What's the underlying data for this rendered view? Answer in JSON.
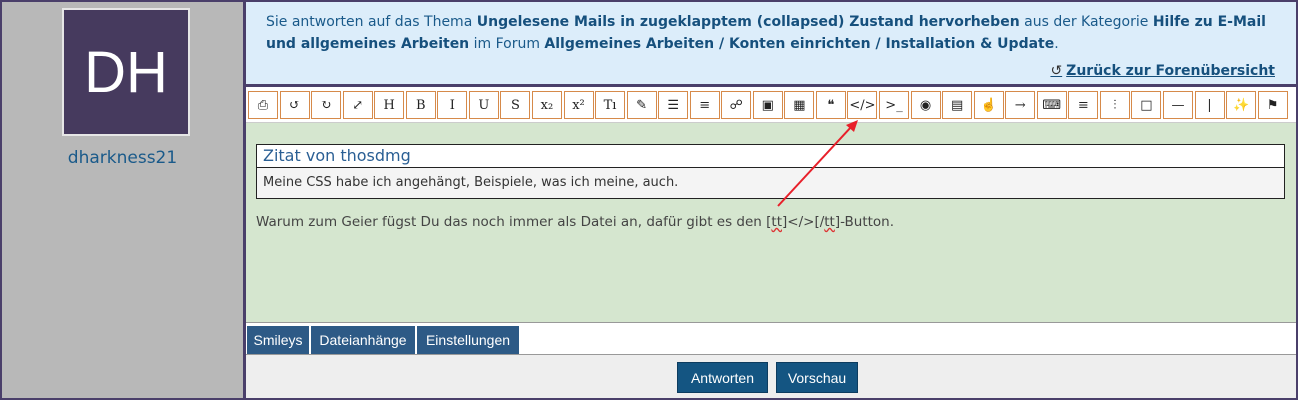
{
  "sidebar": {
    "avatar_initials": "DH",
    "username": "dharkness21"
  },
  "info": {
    "t1": "Sie antworten auf das Thema ",
    "topic": "Ungelesene Mails in zugeklapptem (collapsed) Zustand hervorheben",
    "t2": " aus der Kategorie ",
    "category": "Hilfe zu E-Mail und allgemeines Arbeiten",
    "t3": " im Forum ",
    "forum": "Allgemeines Arbeiten / Konten einrichten / Installation & Update",
    "t4": ".",
    "back_label": "Zurück zur Forenübersicht"
  },
  "toolbar": {
    "buttons": [
      "⎙",
      "↺",
      "↻",
      "⤢",
      "H",
      "B",
      "I",
      "U",
      "S",
      "x₂",
      "x²",
      "Tı",
      "✎",
      "☰",
      "≡",
      "☍",
      "▣",
      "▦",
      "❝",
      "</>",
      ">_",
      "◉",
      "▤",
      "☝",
      "→",
      "⌨",
      "≡",
      "⫶",
      "□",
      "—",
      "|",
      "✨",
      "⚑"
    ]
  },
  "editor": {
    "quote_author": "Zitat von thosdmg",
    "quote_text": "Meine CSS habe ich angehängt, Beispiele, was ich meine, auch.",
    "text_a": "Warum zum Geier fügst Du das noch immer als Datei an, dafür gibt es den [",
    "text_b": "tt",
    "text_c": "]</>[/",
    "text_d": "tt",
    "text_e": "]-Button."
  },
  "tabs": [
    "Smileys",
    "Dateianhänge",
    "Einstellungen"
  ],
  "footer": {
    "submit": "Antworten",
    "preview": "Vorschau"
  },
  "colors": {
    "annotation_arrow": "#e8202a",
    "button": "#145582",
    "tab": "#2d5a86"
  }
}
